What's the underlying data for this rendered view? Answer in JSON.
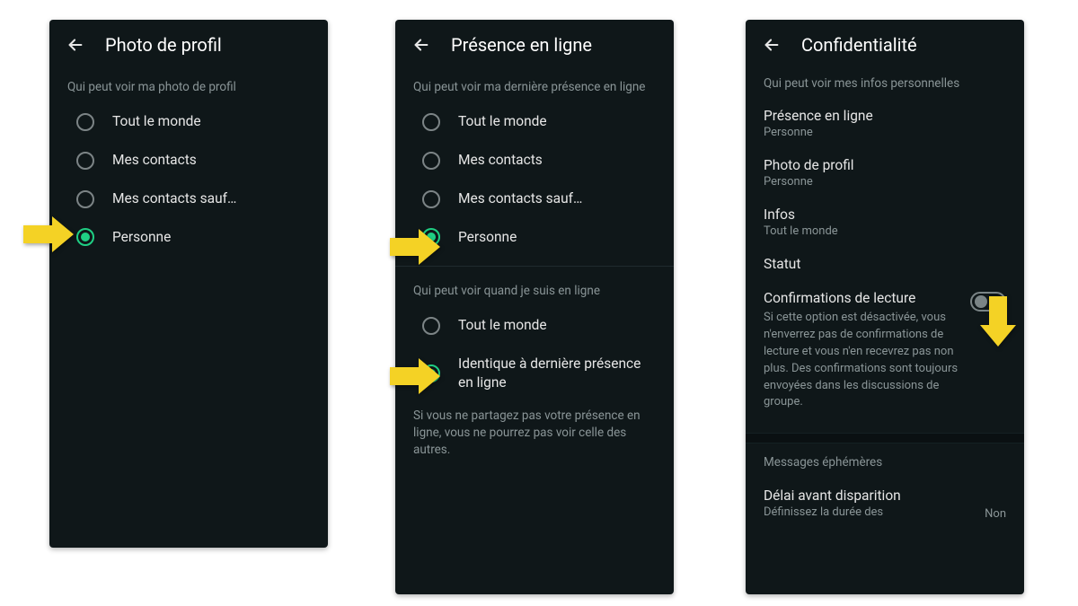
{
  "arrowColor": "#f4d225",
  "phone1": {
    "title": "Photo de profil",
    "section1": {
      "label": "Qui peut voir ma photo de profil",
      "options": [
        "Tout le monde",
        "Mes contacts",
        "Mes contacts sauf…",
        "Personne"
      ],
      "selectedIndex": 3
    }
  },
  "phone2": {
    "title": "Présence en ligne",
    "section1": {
      "label": "Qui peut voir ma dernière présence en ligne",
      "options": [
        "Tout le monde",
        "Mes contacts",
        "Mes contacts sauf…",
        "Personne"
      ],
      "selectedIndex": 3
    },
    "section2": {
      "label": "Qui peut voir quand je suis en ligne",
      "options": [
        "Tout le monde",
        "Identique à dernière présence en ligne"
      ],
      "selectedIndex": 1
    },
    "note": "Si vous ne partagez pas votre présence en ligne, vous ne pourrez pas voir celle des autres."
  },
  "phone3": {
    "title": "Confidentialité",
    "sectionLabel": "Qui peut voir mes infos personnelles",
    "items": [
      {
        "title": "Présence en ligne",
        "value": "Personne"
      },
      {
        "title": "Photo de profil",
        "value": "Personne"
      },
      {
        "title": "Infos",
        "value": "Tout le monde"
      },
      {
        "title": "Statut",
        "value": ""
      }
    ],
    "readReceipts": {
      "title": "Confirmations de lecture",
      "desc": "Si cette option est désactivée, vous n'enverrez pas de confirmations de lecture et vous n'en recevrez pas non plus. Des confirmations sont toujours envoyées dans les discussions de groupe.",
      "enabled": false
    },
    "ephemeral": {
      "sectionLabel": "Messages éphémères",
      "item": {
        "title": "Délai avant disparition",
        "desc": "Définissez la durée des",
        "value": "Non"
      }
    }
  }
}
